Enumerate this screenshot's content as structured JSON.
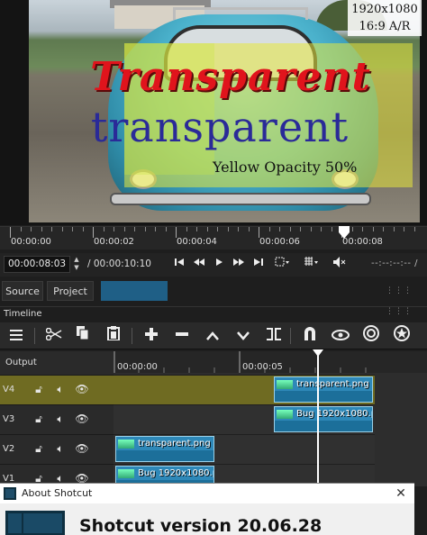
{
  "preview": {
    "overlay_text_red": "Transparent",
    "overlay_text_blue": "transparent",
    "overlay_text_yellow": "Yellow Opacity 50%",
    "resolution_line1": "1920x1080",
    "resolution_line2": "16:9 A/R",
    "colors": {
      "red_text": "#e0141c",
      "blue_text": "#2a2a98",
      "yellow_box": "#e8e83c"
    }
  },
  "ruler": {
    "labels": [
      "00:00:00",
      "00:00:02",
      "00:00:04",
      "00:00:06",
      "00:00:08"
    ]
  },
  "transport": {
    "current_timecode": "00:00:08:03",
    "spin_up": "▲",
    "spin_down": "▼",
    "duration": "/ 00:00:10:10",
    "inout": "--:--:--:-- /",
    "icons": [
      "skip-to-start-icon",
      "rewind-icon",
      "play-icon",
      "fast-forward-icon",
      "skip-to-end-icon",
      "zoom-icon",
      "grid-icon",
      "volume-mute-icon"
    ]
  },
  "tabs": {
    "source": "Source",
    "project": "Project",
    "accent": "#1f5f86"
  },
  "timeline": {
    "title": "Timeline",
    "output_label": "Output",
    "ruler_labels": [
      "00:00:00",
      "00:00:05"
    ],
    "tracks": [
      {
        "name": "V4"
      },
      {
        "name": "V3"
      },
      {
        "name": "V2"
      },
      {
        "name": "V1"
      }
    ],
    "clips": {
      "v4": "transparent.png",
      "v3": "Bug 1920x1080.pn",
      "v2": "transparent.png",
      "v1": "Bug 1920x1080.pn"
    },
    "toolbar_icons": [
      "menu-icon",
      "cut-icon",
      "copy-icon",
      "paste-icon",
      "add-icon",
      "remove-icon",
      "lift-icon",
      "overwrite-icon",
      "split-icon",
      "snap-icon",
      "scrub-icon",
      "ripple-icon",
      "ripple-all-icon"
    ],
    "highlight_color": "#6f6b22",
    "clip_color": "#2e88b8"
  },
  "about": {
    "title": "About Shotcut",
    "close": "✕",
    "version": "Shotcut version 20.06.28"
  }
}
